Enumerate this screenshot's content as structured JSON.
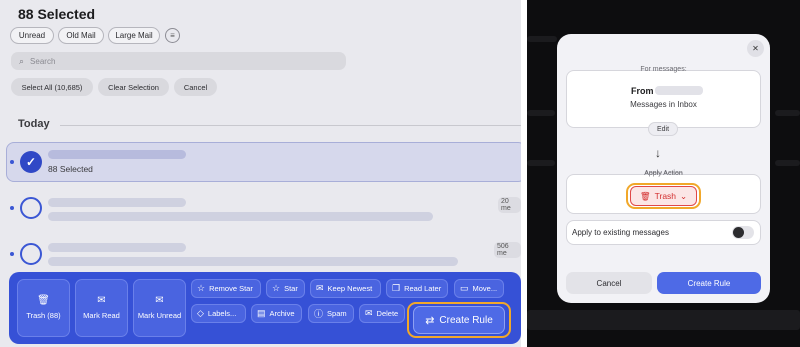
{
  "left_panel": {
    "title": "88 Selected",
    "filter_chips": [
      "Unread",
      "Old Mail",
      "Large Mail"
    ],
    "filter_icon": "filter-icon",
    "search_placeholder": "Search",
    "selection_buttons": [
      "Select All (10,685)",
      "Clear Selection",
      "Cancel"
    ],
    "section_heading": "Today",
    "selected_row_text": "88 Selected",
    "row_counts": [
      "20 me",
      "506 me"
    ],
    "toolbar": {
      "large_buttons": [
        {
          "label": "Trash (88)",
          "icon": "trash-icon"
        },
        {
          "label": "Mark Read",
          "icon": "envelope-open-icon"
        },
        {
          "label": "Mark Unread",
          "icon": "envelope-icon"
        }
      ],
      "row1": [
        {
          "label": "Remove Star",
          "icon": "star-slash-icon"
        },
        {
          "label": "Star",
          "icon": "star-icon"
        },
        {
          "label": "Keep Newest",
          "icon": "mail-check-icon"
        },
        {
          "label": "Read Later",
          "icon": "bookmark-icon"
        },
        {
          "label": "Move...",
          "icon": "folder-icon"
        }
      ],
      "row2": [
        {
          "label": "Labels...",
          "icon": "tag-icon"
        },
        {
          "label": "Archive",
          "icon": "archive-icon"
        },
        {
          "label": "Spam",
          "icon": "alert-circle-icon"
        },
        {
          "label": "Delete",
          "icon": "mail-x-icon"
        }
      ],
      "create_rule": "Create Rule"
    }
  },
  "rule_modal": {
    "for_messages_label": "For messages:",
    "from_label": "From",
    "subtitle": "Messages in Inbox",
    "edit_label": "Edit",
    "apply_action_label": "Apply Action",
    "action_label": "Trash",
    "apply_existing_label": "Apply to existing messages",
    "apply_existing_on": false,
    "cancel_label": "Cancel",
    "create_label": "Create Rule"
  },
  "colors": {
    "accent": "#3651d6",
    "highlight": "#f1a82a",
    "danger": "#d32f2f"
  }
}
